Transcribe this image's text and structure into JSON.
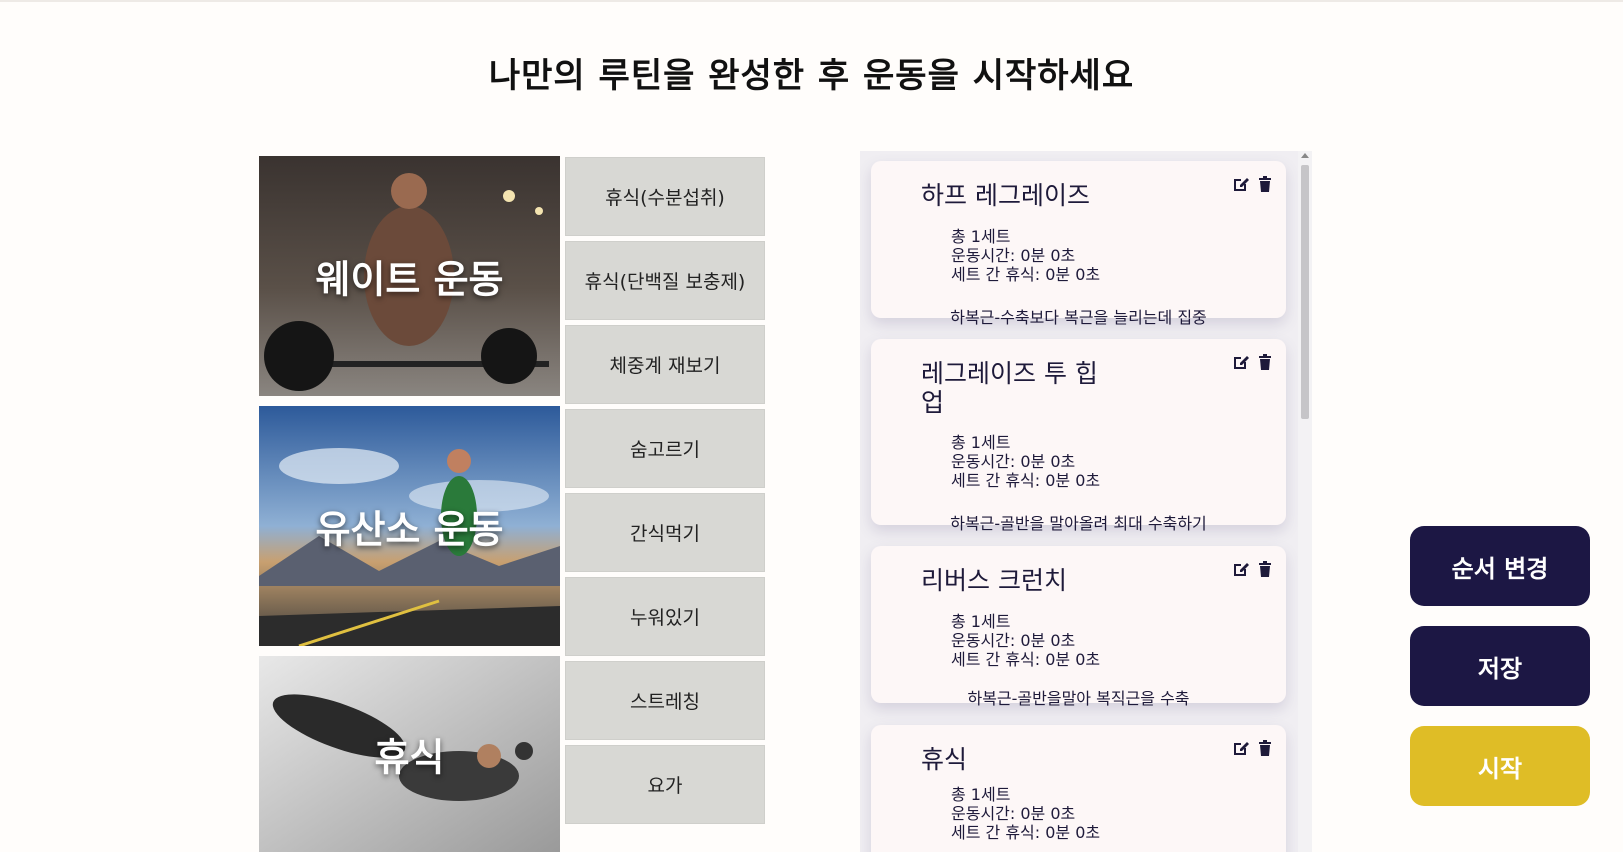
{
  "page": {
    "title": "나만의 루틴을 완성한 후 운동을 시작하세요"
  },
  "categories": [
    {
      "label": "웨이트 운동"
    },
    {
      "label": "유산소 운동"
    },
    {
      "label": "휴식"
    }
  ],
  "sub_activities": [
    "휴식(수분섭취)",
    "휴식(단백질 보충제)",
    "체중계 재보기",
    "숨고르기",
    "간식먹기",
    "누워있기",
    "스트레칭",
    "요가"
  ],
  "routine": [
    {
      "title": "하프 레그레이즈",
      "sets": "총 1세트",
      "duration": "운동시간: 0분 0초",
      "rest": "세트 간 휴식: 0분 0초",
      "description": "하복근-수축보다 복근을 늘리는데 집중"
    },
    {
      "title": "레그레이즈 투 힙업",
      "sets": "총 1세트",
      "duration": "운동시간: 0분 0초",
      "rest": "세트 간 휴식: 0분 0초",
      "description": "하복근-골반을 말아올려 최대 수축하기"
    },
    {
      "title": "리버스 크런치",
      "sets": "총 1세트",
      "duration": "운동시간: 0분 0초",
      "rest": "세트 간 휴식: 0분 0초",
      "description": "하복근-골반을말아 복직근을 수축"
    },
    {
      "title": "휴식",
      "sets": "총 1세트",
      "duration": "운동시간: 0분 0초",
      "rest": "세트 간 휴식: 0분 0초",
      "description": ""
    }
  ],
  "actions": {
    "reorder_label": "순서 변경",
    "save_label": "저장",
    "start_label": "시작"
  },
  "colors": {
    "primary_button": "#1c1744",
    "start_button": "#dfbd26",
    "sub_button": "#d8d8d4"
  },
  "icons": {
    "edit": "edit-icon",
    "delete": "trash-icon"
  }
}
